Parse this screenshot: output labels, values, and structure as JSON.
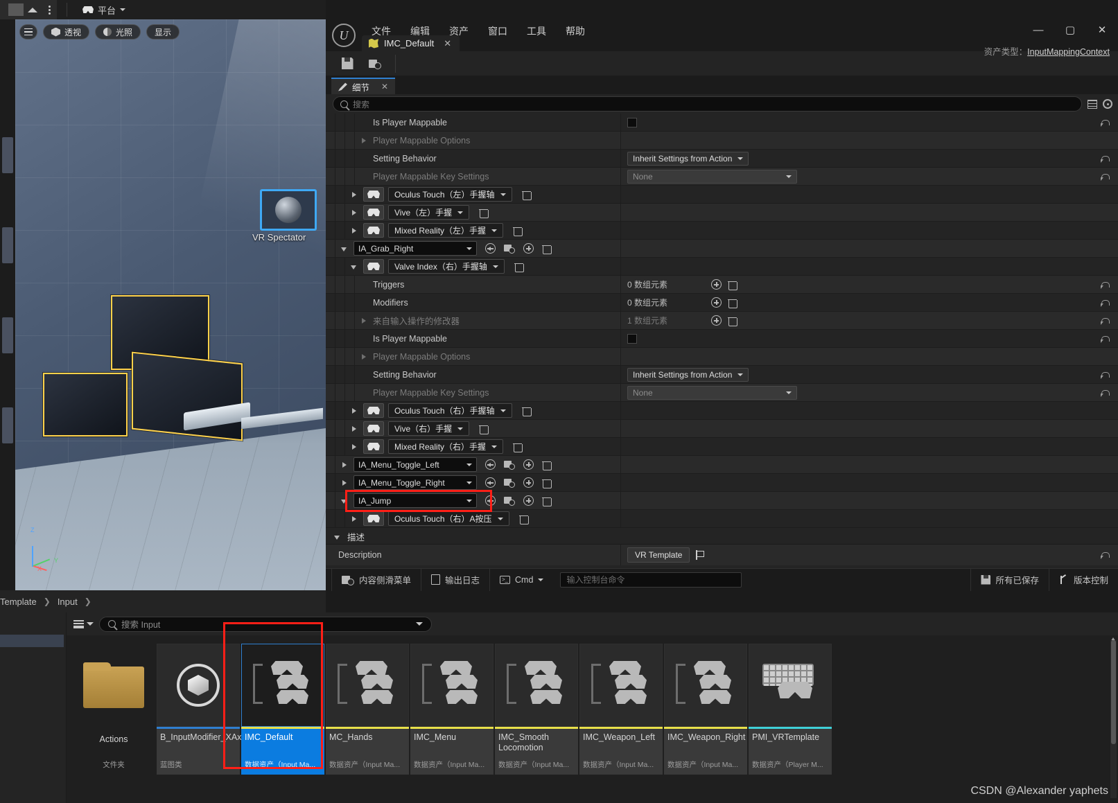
{
  "topstrip": {
    "platform_label": "平台"
  },
  "viewport": {
    "hamburger": "hamburger-icon",
    "perspective": "透视",
    "lit": "光照",
    "show": "显示",
    "spectator_label": "VR Spectator",
    "gizmo": {
      "z": "Z",
      "x": "X",
      "y": "Y"
    }
  },
  "editor": {
    "menus": [
      "文件",
      "编辑",
      "资产",
      "窗口",
      "工具",
      "帮助"
    ],
    "window_buttons": {
      "minimize": "—",
      "maximize": "▢",
      "close": "✕"
    },
    "tab": {
      "label": "IMC_Default",
      "close": "✕",
      "icon": "imc-asset-icon"
    },
    "asset_type_prefix": "资产类型：",
    "asset_type_value": "InputMappingContext",
    "toolbar": {
      "save": "save-icon",
      "browse": "browse-to-asset-icon"
    },
    "details_tab": {
      "label": "细节",
      "close": "✕"
    },
    "search": {
      "placeholder": "搜索"
    }
  },
  "properties": {
    "rows": [
      {
        "kind": "prop",
        "indent": 3,
        "label": "Is Player Mappable",
        "control": "checkbox",
        "dim": false,
        "revert": true
      },
      {
        "kind": "prop",
        "indent": 3,
        "label": "Player Mappable Options",
        "control": "expand",
        "dim": true,
        "revert": false
      },
      {
        "kind": "prop",
        "indent": 3,
        "label": "Setting Behavior",
        "control": "combo",
        "value": "Inherit Settings from Action",
        "dim": false,
        "revert": true
      },
      {
        "kind": "prop",
        "indent": 3,
        "label": "Player Mappable Key Settings",
        "control": "combo-wide",
        "value": "None",
        "dim": true,
        "revert": true
      },
      {
        "kind": "key",
        "indent": 2,
        "label": "Oculus Touch（左）手握轴",
        "revert": false
      },
      {
        "kind": "key",
        "indent": 2,
        "label": "Vive（左）手握",
        "revert": false
      },
      {
        "kind": "key",
        "indent": 2,
        "label": "Mixed Reality（左）手握",
        "revert": false
      },
      {
        "kind": "action",
        "indent": 1,
        "label": "IA_Grab_Right",
        "expanded": true,
        "revert": false
      },
      {
        "kind": "key",
        "indent": 2,
        "label": "Valve Index（右）手握轴",
        "expanded": true,
        "revert": false
      },
      {
        "kind": "array",
        "indent": 3,
        "label": "Triggers",
        "count": "0 数组元素",
        "dim": false,
        "revert": true
      },
      {
        "kind": "array",
        "indent": 3,
        "label": "Modifiers",
        "count": "0 数组元素",
        "dim": false,
        "revert": true
      },
      {
        "kind": "array",
        "indent": 3,
        "label": "来自输入操作的修改器",
        "count": "1 数组元素",
        "dim": true,
        "revert": true
      },
      {
        "kind": "prop",
        "indent": 3,
        "label": "Is Player Mappable",
        "control": "checkbox",
        "dim": false,
        "revert": true
      },
      {
        "kind": "prop",
        "indent": 3,
        "label": "Player Mappable Options",
        "control": "expand",
        "dim": true,
        "revert": false
      },
      {
        "kind": "prop",
        "indent": 3,
        "label": "Setting Behavior",
        "control": "combo",
        "value": "Inherit Settings from Action",
        "dim": false,
        "revert": true
      },
      {
        "kind": "prop",
        "indent": 3,
        "label": "Player Mappable Key Settings",
        "control": "combo-wide",
        "value": "None",
        "dim": true,
        "revert": true
      },
      {
        "kind": "key",
        "indent": 2,
        "label": "Oculus Touch（右）手握轴",
        "revert": false
      },
      {
        "kind": "key",
        "indent": 2,
        "label": "Vive（右）手握",
        "revert": false
      },
      {
        "kind": "key",
        "indent": 2,
        "label": "Mixed Reality（右）手握",
        "revert": false
      },
      {
        "kind": "action",
        "indent": 1,
        "label": "IA_Menu_Toggle_Left",
        "expanded": false,
        "revert": false
      },
      {
        "kind": "action",
        "indent": 1,
        "label": "IA_Menu_Toggle_Right",
        "expanded": false,
        "revert": false
      },
      {
        "kind": "action",
        "indent": 1,
        "label": "IA_Jump",
        "expanded": true,
        "highlight": true,
        "revert": false
      },
      {
        "kind": "key",
        "indent": 2,
        "label": "Oculus Touch（右）A按压",
        "revert": false
      }
    ]
  },
  "description": {
    "header": "描述",
    "label": "Description",
    "value": "VR Template"
  },
  "statusbar": {
    "content_drawer": "内容侧滑菜单",
    "output_log": "输出日志",
    "cmd": "Cmd",
    "cmd_placeholder": "输入控制台命令",
    "all_saved": "所有已保存",
    "source_control": "版本控制"
  },
  "breadcrumb": {
    "items": [
      "Template",
      "Input"
    ],
    "separator": "❯"
  },
  "content_browser": {
    "search_placeholder": "搜索 Input",
    "tiles": [
      {
        "name": "Actions",
        "sub": "文件夹",
        "icon": "folder-icon",
        "stripe": "",
        "selected": false,
        "type": "folder"
      },
      {
        "name": "B_InputModifier_XAxisPositiveOnly",
        "sub": "蓝图类",
        "icon": "blueprint-sphere-icon",
        "stripe": "#2f7fd0",
        "selected": false,
        "type": "asset"
      },
      {
        "name": "IMC_Default",
        "sub": "数据资产（Input Ma...",
        "icon": "imc-icon",
        "stripe": "#e8e04a",
        "selected": true,
        "type": "asset"
      },
      {
        "name": "MC_Hands",
        "sub": "数据资产（Input Ma...",
        "icon": "imc-icon",
        "stripe": "#e8e04a",
        "selected": false,
        "type": "asset"
      },
      {
        "name": "IMC_Menu",
        "sub": "数据资产（Input Ma...",
        "icon": "imc-icon",
        "stripe": "#e8e04a",
        "selected": false,
        "type": "asset"
      },
      {
        "name": "IMC_Smooth Locomotion",
        "sub": "数据资产（Input Ma...",
        "icon": "imc-icon",
        "stripe": "#e8e04a",
        "selected": false,
        "type": "asset"
      },
      {
        "name": "IMC_Weapon_Left",
        "sub": "数据资产（Input Ma...",
        "icon": "imc-icon",
        "stripe": "#e8e04a",
        "selected": false,
        "type": "asset"
      },
      {
        "name": "IMC_Weapon_Right",
        "sub": "数据资产（Input Ma...",
        "icon": "imc-icon",
        "stripe": "#e8e04a",
        "selected": false,
        "type": "asset"
      },
      {
        "name": "PMI_VRTemplate",
        "sub": "数据资产（Player M...",
        "icon": "pmi-icon",
        "stripe": "#3fd0d8",
        "selected": false,
        "type": "asset"
      }
    ]
  },
  "watermark": "CSDN @Alexander yaphets",
  "colors": {
    "accent": "#0b7ce0",
    "highlight": "#ff1f17",
    "stripe_imc": "#e8e04a",
    "stripe_bp": "#2f7fd0",
    "stripe_pmi": "#3fd0d8"
  }
}
